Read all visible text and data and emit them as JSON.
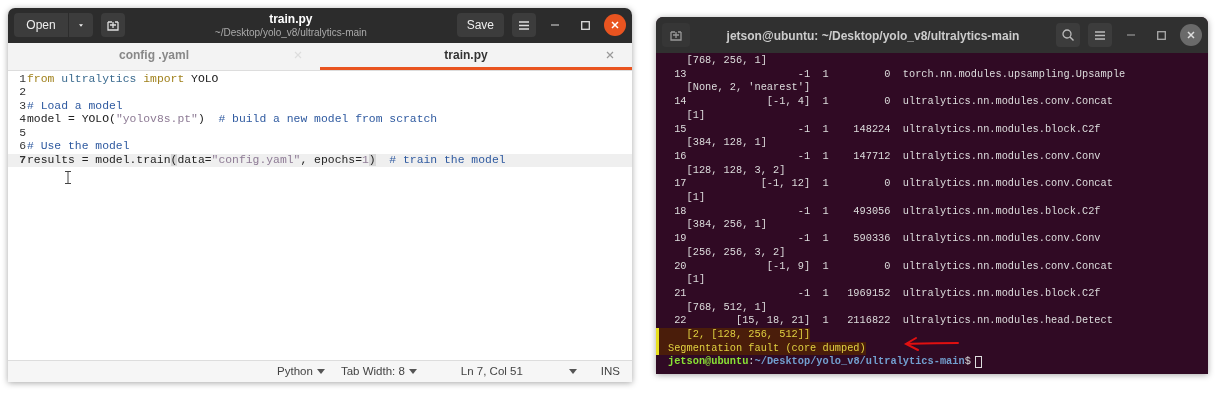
{
  "editor": {
    "title": "train.py",
    "path": "~/Desktop/yolo_v8/ultralytics-main",
    "open_button": "Open",
    "save_button": "Save",
    "tabs": [
      {
        "label": "config .yaml",
        "selected": false
      },
      {
        "label": "train.py",
        "selected": true
      }
    ],
    "lines": [
      {
        "number": "1",
        "current": false,
        "tokens": [
          {
            "text": "from",
            "kind": "keyword"
          },
          {
            "text": " ultralytics",
            "kind": "module"
          },
          {
            "text": " import",
            "kind": "keyword"
          },
          {
            "text": " YOLO",
            "kind": "plain"
          }
        ]
      },
      {
        "number": "2",
        "current": false
      },
      {
        "number": "3",
        "current": false,
        "tokens": [
          {
            "text": "# Load a model",
            "kind": "comment"
          }
        ]
      },
      {
        "number": "4",
        "current": false,
        "tokens": [
          {
            "text": "model = YOLO(",
            "kind": "plain"
          },
          {
            "text": "\"yolov8s.pt\"",
            "kind": "string"
          },
          {
            "text": ")  ",
            "kind": "plain"
          },
          {
            "text": "# build a new model from scratch",
            "kind": "comment"
          }
        ]
      },
      {
        "number": "5",
        "current": false
      },
      {
        "number": "6",
        "current": false,
        "tokens": [
          {
            "text": "# Use the model",
            "kind": "comment"
          }
        ]
      },
      {
        "number": "7",
        "current": true,
        "tokens": [
          {
            "text": "results = model.train",
            "kind": "plain"
          },
          {
            "text": "(",
            "kind": "bracket"
          },
          {
            "text": "data=",
            "kind": "plain"
          },
          {
            "text": "\"config.yaml\"",
            "kind": "string"
          },
          {
            "text": ", epochs=",
            "kind": "plain"
          },
          {
            "text": "1",
            "kind": "number"
          },
          {
            "text": ")",
            "kind": "bracket"
          },
          {
            "text": "  # train the model",
            "kind": "comment"
          }
        ]
      }
    ],
    "status": {
      "language": "Python",
      "tab_width": "Tab Width: 8",
      "position": "Ln 7, Col 51",
      "mode": "INS"
    }
  },
  "terminal": {
    "title": "jetson@ubuntu: ~/Desktop/yolo_v8/ultralytics-main",
    "lines": [
      {
        "text": "   [768, 256, 1]",
        "kind": "output"
      },
      {
        "text": " 13                  -1  1         0  torch.nn.modules.upsampling.Upsample",
        "kind": "output"
      },
      {
        "text": "   [None, 2, 'nearest']",
        "kind": "output"
      },
      {
        "text": " 14             [-1, 4]  1         0  ultralytics.nn.modules.conv.Concat",
        "kind": "output"
      },
      {
        "text": "   [1]",
        "kind": "output"
      },
      {
        "text": " 15                  -1  1    148224  ultralytics.nn.modules.block.C2f",
        "kind": "output"
      },
      {
        "text": "   [384, 128, 1]",
        "kind": "output"
      },
      {
        "text": " 16                  -1  1    147712  ultralytics.nn.modules.conv.Conv",
        "kind": "output"
      },
      {
        "text": "   [128, 128, 3, 2]",
        "kind": "output"
      },
      {
        "text": " 17            [-1, 12]  1         0  ultralytics.nn.modules.conv.Concat",
        "kind": "output"
      },
      {
        "text": "   [1]",
        "kind": "output"
      },
      {
        "text": " 18                  -1  1    493056  ultralytics.nn.modules.block.C2f",
        "kind": "output"
      },
      {
        "text": "   [384, 256, 1]",
        "kind": "output"
      },
      {
        "text": " 19                  -1  1    590336  ultralytics.nn.modules.conv.Conv",
        "kind": "output"
      },
      {
        "text": "   [256, 256, 3, 2]",
        "kind": "output"
      },
      {
        "text": " 20             [-1, 9]  1         0  ultralytics.nn.modules.conv.Concat",
        "kind": "output"
      },
      {
        "text": "   [1]",
        "kind": "output"
      },
      {
        "text": " 21                  -1  1   1969152  ultralytics.nn.modules.block.C2f",
        "kind": "output"
      },
      {
        "text": "   [768, 512, 1]",
        "kind": "output"
      },
      {
        "text": " 22        [15, 18, 21]  1   2116822  ultralytics.nn.modules.head.Detect",
        "kind": "output"
      },
      {
        "text": "   [2, [128, 256, 512]]",
        "kind": "highlight"
      },
      {
        "text": "Segmentation fault (core dumped)",
        "kind": "highlight"
      }
    ],
    "prompt": {
      "user_host": "jetson@ubuntu",
      "separator": ":",
      "path": "~/Desktop/yolo_v8/ultralytics-main",
      "symbol": "$"
    }
  }
}
